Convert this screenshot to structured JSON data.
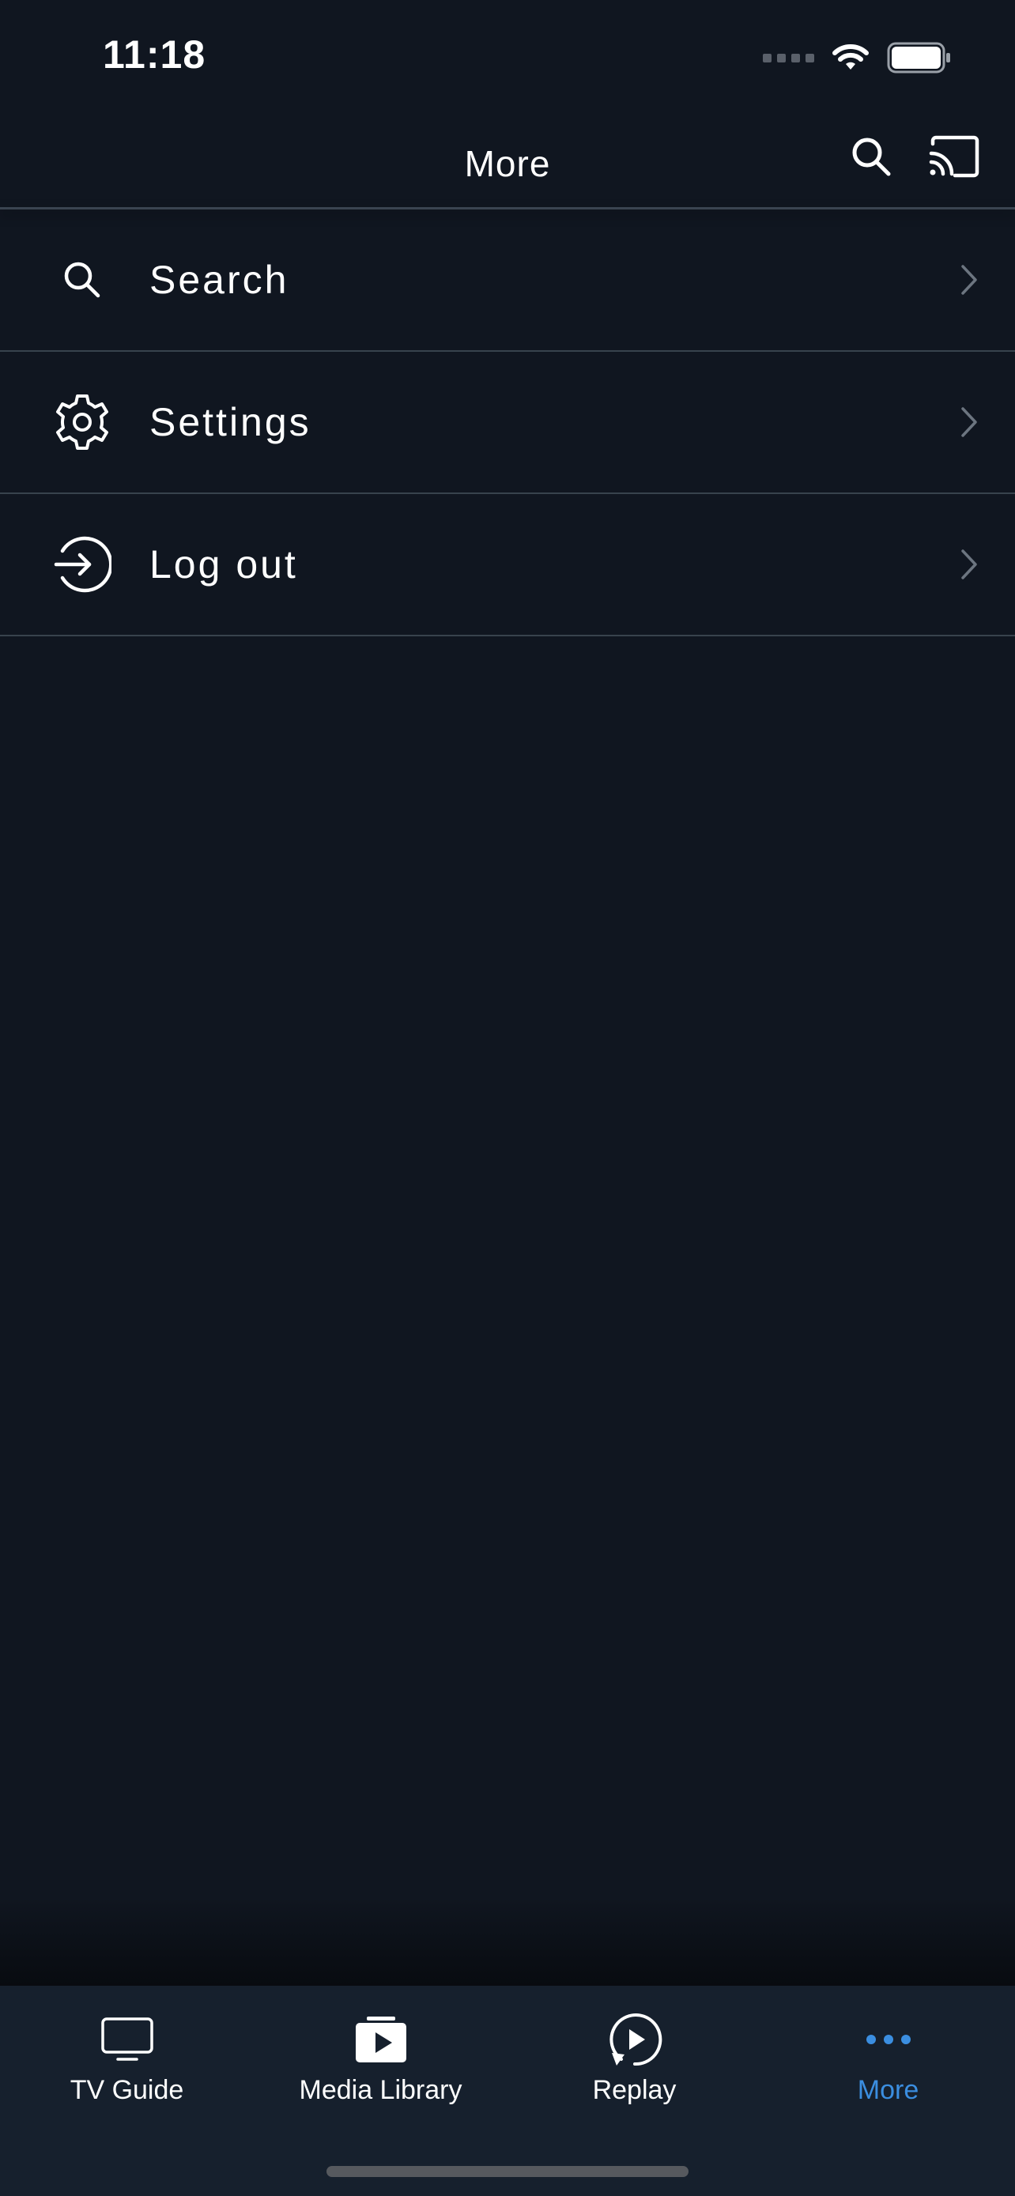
{
  "status_bar": {
    "time": "11:18"
  },
  "header": {
    "title": "More",
    "search_icon": "search-icon",
    "cast_icon": "cast-icon"
  },
  "menu": {
    "items": [
      {
        "label": "Search",
        "icon": "search-icon"
      },
      {
        "label": "Settings",
        "icon": "gear-icon"
      },
      {
        "label": "Log out",
        "icon": "log-out-icon"
      }
    ]
  },
  "tab_bar": {
    "tabs": [
      {
        "label": "TV Guide",
        "icon": "tv-icon",
        "active": false
      },
      {
        "label": "Media Library",
        "icon": "media-library-icon",
        "active": false
      },
      {
        "label": "Replay",
        "icon": "replay-icon",
        "active": false
      },
      {
        "label": "More",
        "icon": "more-dots-icon",
        "active": true
      }
    ]
  },
  "colors": {
    "background": "#101620",
    "tab_bar_background": "#16202d",
    "accent": "#3b8ee0",
    "divider": "#38434d"
  }
}
